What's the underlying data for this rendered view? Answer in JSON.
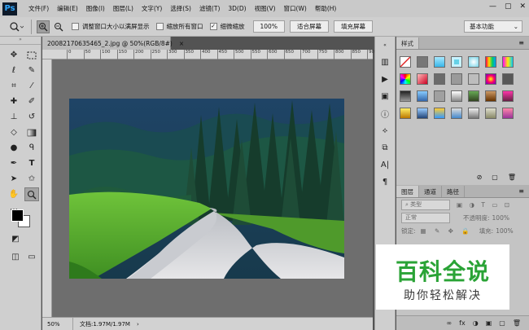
{
  "app": {
    "logo": "Ps"
  },
  "menu": [
    "文件(F)",
    "编辑(E)",
    "图像(I)",
    "图层(L)",
    "文字(Y)",
    "选择(S)",
    "滤镜(T)",
    "3D(D)",
    "视图(V)",
    "窗口(W)",
    "帮助(H)"
  ],
  "window_controls": {
    "minimize": "—",
    "restore": "▢",
    "close": "✕"
  },
  "options": {
    "resize_window_label": "调整窗口大小以满屏显示",
    "zoom_all_label": "缩放所有窗口",
    "scrubby_zoom_label": "细微缩放",
    "zoom_pct": "100%",
    "fit_screen": "适合屏幕",
    "fill_screen": "填充屏幕",
    "workspace": "基本功能"
  },
  "document": {
    "tab_title": "20082170635465_2.jpg @ 50%(RGB/8#)",
    "tab_close": "×",
    "ruler_labels": [
      "0",
      "50",
      "100",
      "150",
      "200",
      "250",
      "300",
      "350",
      "400",
      "450",
      "500",
      "550",
      "600",
      "650",
      "700",
      "750",
      "800",
      "850",
      "900"
    ],
    "status_zoom": "50%",
    "status_doc": "文档:1.97M/1.97M",
    "status_arrow": "›"
  },
  "swatches_panel": {
    "tab": "样式",
    "menu": "≡"
  },
  "layers_panel": {
    "tabs": [
      "图层",
      "通道",
      "路径"
    ],
    "kind": "类型",
    "blend": "正常",
    "opacity_label": "不透明度:",
    "opacity": "100%",
    "lock_label": "锁定:",
    "fill_label": "填充:",
    "fill": "100%",
    "footer_icons": [
      "∞",
      "fx",
      "◑",
      "▣",
      "▢",
      "🗑"
    ]
  },
  "watermark": {
    "title": "百科全说",
    "subtitle": "助你轻松解决"
  },
  "colors": {
    "accent": "#31a8ff",
    "watermark_green": "#2aa336",
    "ui_panel": "#c4c4c4"
  }
}
